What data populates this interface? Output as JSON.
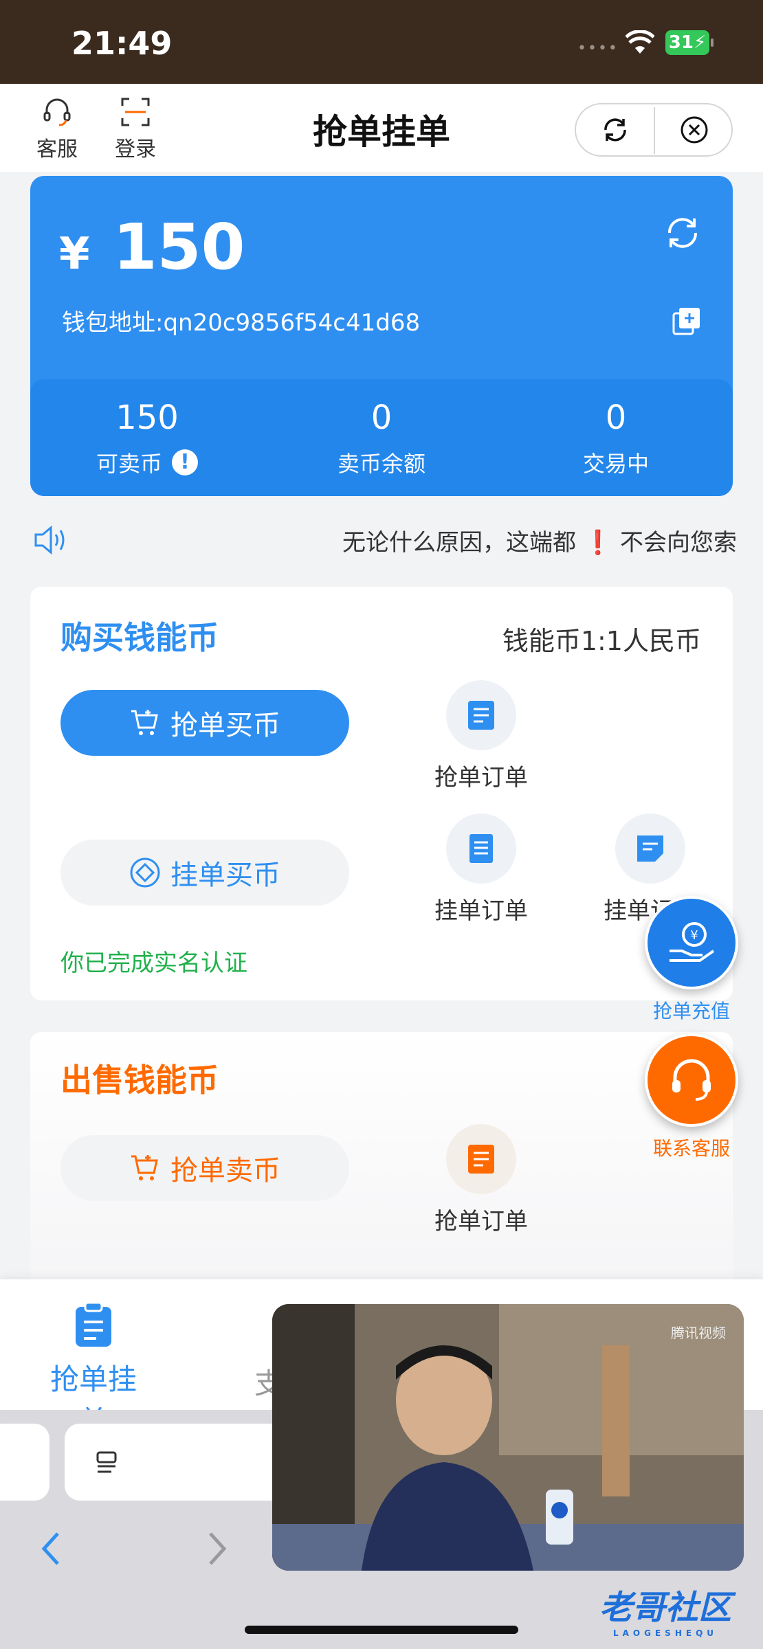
{
  "status_bar": {
    "time": "21:49",
    "battery": "31"
  },
  "nav": {
    "service_label": "客服",
    "login_label": "登录",
    "title": "抢单挂单"
  },
  "wallet": {
    "currency": "¥",
    "amount": "150",
    "address": "钱包地址:qn20c9856f54c41d68",
    "stats": [
      {
        "value": "150",
        "label": "可卖币"
      },
      {
        "value": "0",
        "label": "卖币余额"
      },
      {
        "value": "0",
        "label": "交易中"
      }
    ]
  },
  "notice": {
    "text_before": "无论什么原因，这端都",
    "mark": "❗",
    "text_after": "不会向您索"
  },
  "buy": {
    "title": "购买钱能币",
    "rate": "钱能币1:1人民币",
    "grab_buy": "抢单买币",
    "hang_buy": "挂单买币",
    "grab_orders": "抢单订单",
    "hang_orders": "挂单订单",
    "hang_records": "挂单记录",
    "verified": "你已完成实名认证"
  },
  "sell": {
    "title": "出售钱能币",
    "grab_sell": "抢单卖币",
    "grab_orders": "抢单订单"
  },
  "floating": {
    "recharge": "抢单充值",
    "contact": "联系客服"
  },
  "tabbar": {
    "tab1": "抢单挂单",
    "tab2": "支"
  },
  "video": {
    "watermark": "腾讯视频"
  },
  "logo": {
    "text": "老哥社区",
    "sub": "LAOGESHEQU"
  },
  "colors": {
    "primary": "#2f8ff0",
    "orange": "#ff6a00",
    "green": "#22b14c"
  }
}
